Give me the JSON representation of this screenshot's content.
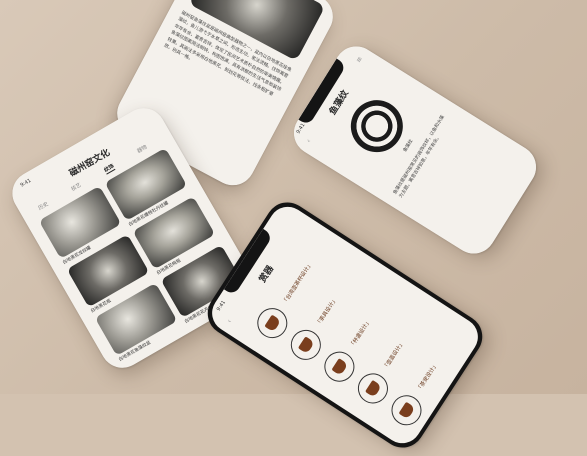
{
  "phone_article": {
    "paragraph": "磁州窑鱼藻纹盆是磁州窑典型器物之一，盆内以白地黑花绘鱼藻纹，鱼儿游弋于水草之间，形态生动，笔法流畅。纹饰寓意年年有余，富贵吉祥，体现了民间艺术质朴自然的审美情趣。鱼藻纹图案简洁明快，构图饱满，具有浓郁的生活气息和装饰效果。其画法多采用白地黑花、刻划花等技法，线条粗犷豪放，别具一格。"
  },
  "phone_fish": {
    "title": "鱼藻纹",
    "status_time": "9:41",
    "caption": "鱼藻纹",
    "paragraph": "鱼藻纹是磁州窑常见的装饰纹样，以鱼和水藻为主题，寓意吉祥如意，年年有余。",
    "back_icon": "chevron-left-icon",
    "menu_icon": "menu-icon"
  },
  "phone_gallery": {
    "title": "磁州窑文化",
    "status_time": "9:41",
    "tabs": [
      "历史",
      "技艺",
      "纹饰",
      "器物"
    ],
    "active_tab_index": 2,
    "items": [
      {
        "caption": "白地黑花龙纹罐"
      },
      {
        "caption": "白地黑花缠枝牡丹纹罐"
      },
      {
        "caption": "白地黑花瓶"
      },
      {
        "caption": "白地黑花梅瓶"
      },
      {
        "caption": "白地黑花鱼藻纹盆"
      },
      {
        "caption": "白地黑花花卉纹罐"
      }
    ]
  },
  "phone_cups": {
    "title": "赏器",
    "status_time": "9:41",
    "labels": [
      "「台湾壶茶杯设计」",
      "「茶具设计」",
      "「杯盏设计」",
      "「壶盖设计」",
      "「茶宠设计」"
    ],
    "back_icon": "chevron-left-icon"
  }
}
